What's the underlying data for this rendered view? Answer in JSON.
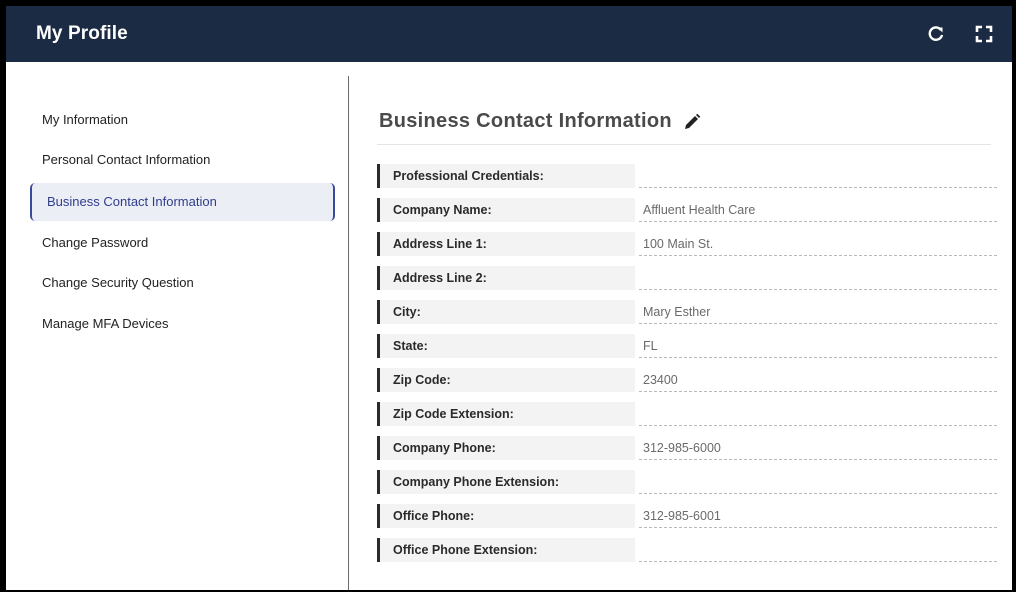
{
  "header": {
    "title": "My Profile",
    "refresh_icon": "refresh-icon",
    "fullscreen_icon": "fullscreen-icon",
    "background": "#1c2b44"
  },
  "sidebar": {
    "items": [
      {
        "label": "My Information",
        "active": false
      },
      {
        "label": "Personal Contact Information",
        "active": false
      },
      {
        "label": "Business Contact Information",
        "active": true
      },
      {
        "label": "Change Password",
        "active": false
      },
      {
        "label": "Change Security Question",
        "active": false
      },
      {
        "label": "Manage MFA Devices",
        "active": false
      }
    ],
    "accent": "#3a4a9a"
  },
  "main": {
    "title": "Business Contact Information",
    "edit_icon": "pencil-icon",
    "fields": [
      {
        "label": "Professional Credentials:",
        "value": ""
      },
      {
        "label": "Company Name:",
        "value": "Affluent Health Care"
      },
      {
        "label": "Address Line 1:",
        "value": "100 Main St."
      },
      {
        "label": "Address Line 2:",
        "value": ""
      },
      {
        "label": "City:",
        "value": "Mary Esther"
      },
      {
        "label": "State:",
        "value": "FL"
      },
      {
        "label": "Zip Code:",
        "value": "23400"
      },
      {
        "label": "Zip Code Extension:",
        "value": ""
      },
      {
        "label": "Company Phone:",
        "value": "312-985-6000"
      },
      {
        "label": "Company Phone Extension:",
        "value": ""
      },
      {
        "label": "Office Phone:",
        "value": "312-985-6001"
      },
      {
        "label": "Office Phone Extension:",
        "value": ""
      }
    ]
  }
}
